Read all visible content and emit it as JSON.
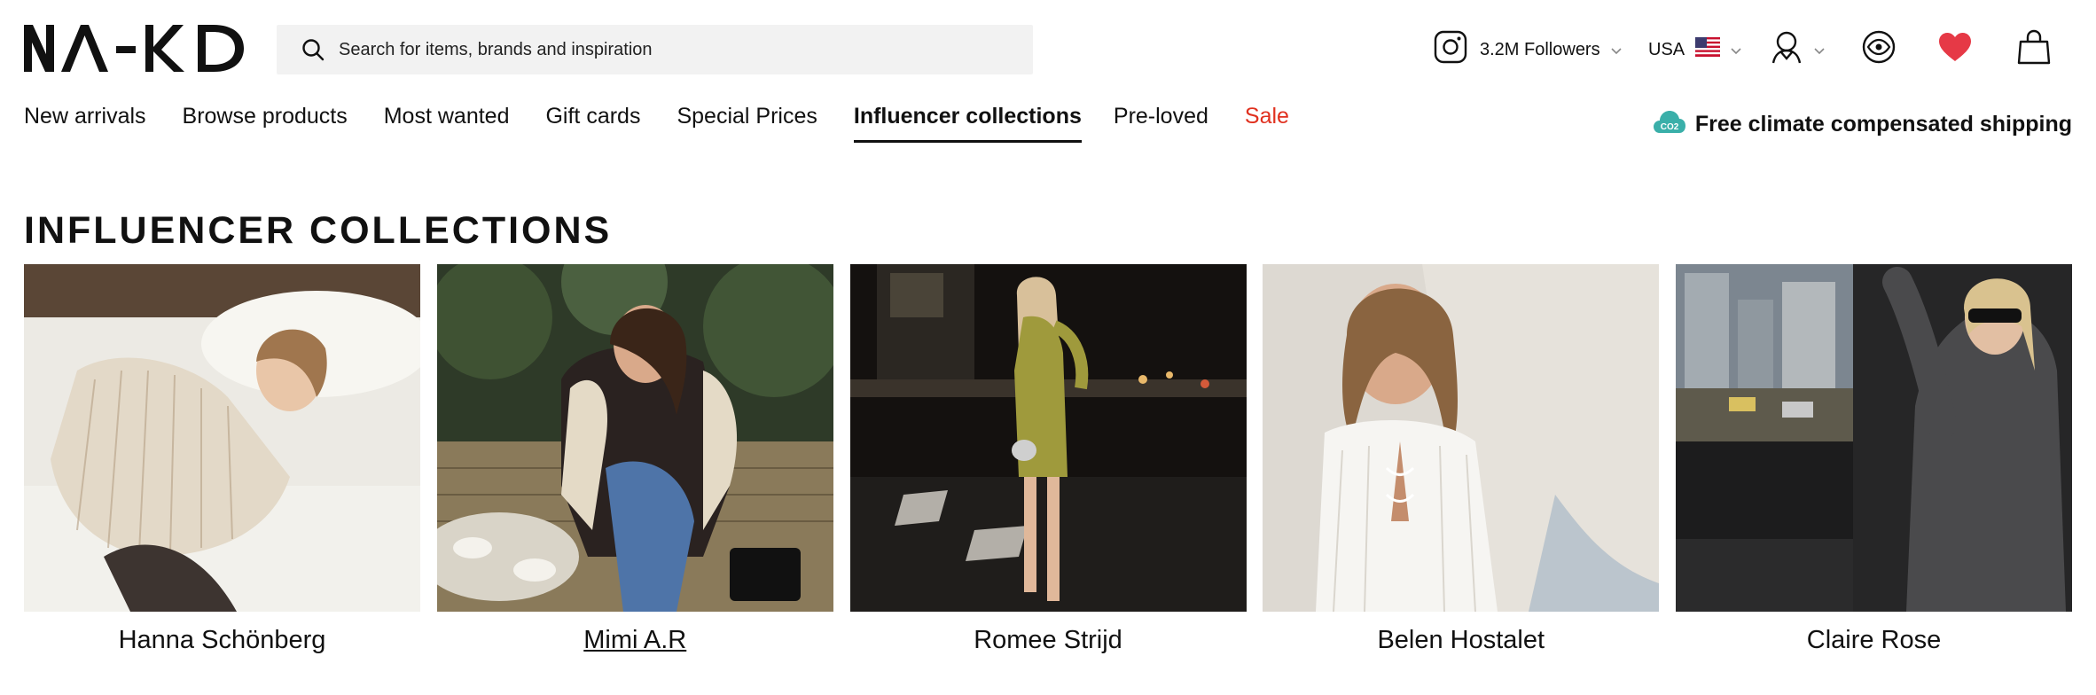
{
  "brand": {
    "name": "NA-KD"
  },
  "search": {
    "placeholder": "Search for items, brands and inspiration"
  },
  "header": {
    "followers": "3.2M Followers",
    "country": "USA",
    "icons": [
      "instagram-icon",
      "us-flag-icon",
      "account-icon",
      "visibility-icon",
      "heart-icon",
      "bag-icon"
    ],
    "heart_color": "#e63946"
  },
  "nav": {
    "items": [
      {
        "label": "New arrivals"
      },
      {
        "label": "Browse products"
      },
      {
        "label": "Most wanted"
      },
      {
        "label": "Gift cards"
      },
      {
        "label": "Special Prices"
      },
      {
        "label": "Influencer collections",
        "active": true
      },
      {
        "label": "Pre-loved"
      },
      {
        "label": "Sale",
        "color": "#e0301e"
      }
    ],
    "climate_badge": "CO2",
    "climate_text": "Free climate compensated shipping"
  },
  "page": {
    "title": "INFLUENCER COLLECTIONS"
  },
  "collections": [
    {
      "name": "Hanna Schönberg"
    },
    {
      "name": "Mimi A.R",
      "hovered": true
    },
    {
      "name": "Romee Strijd"
    },
    {
      "name": "Belen Hostalet"
    },
    {
      "name": "Claire Rose"
    }
  ]
}
